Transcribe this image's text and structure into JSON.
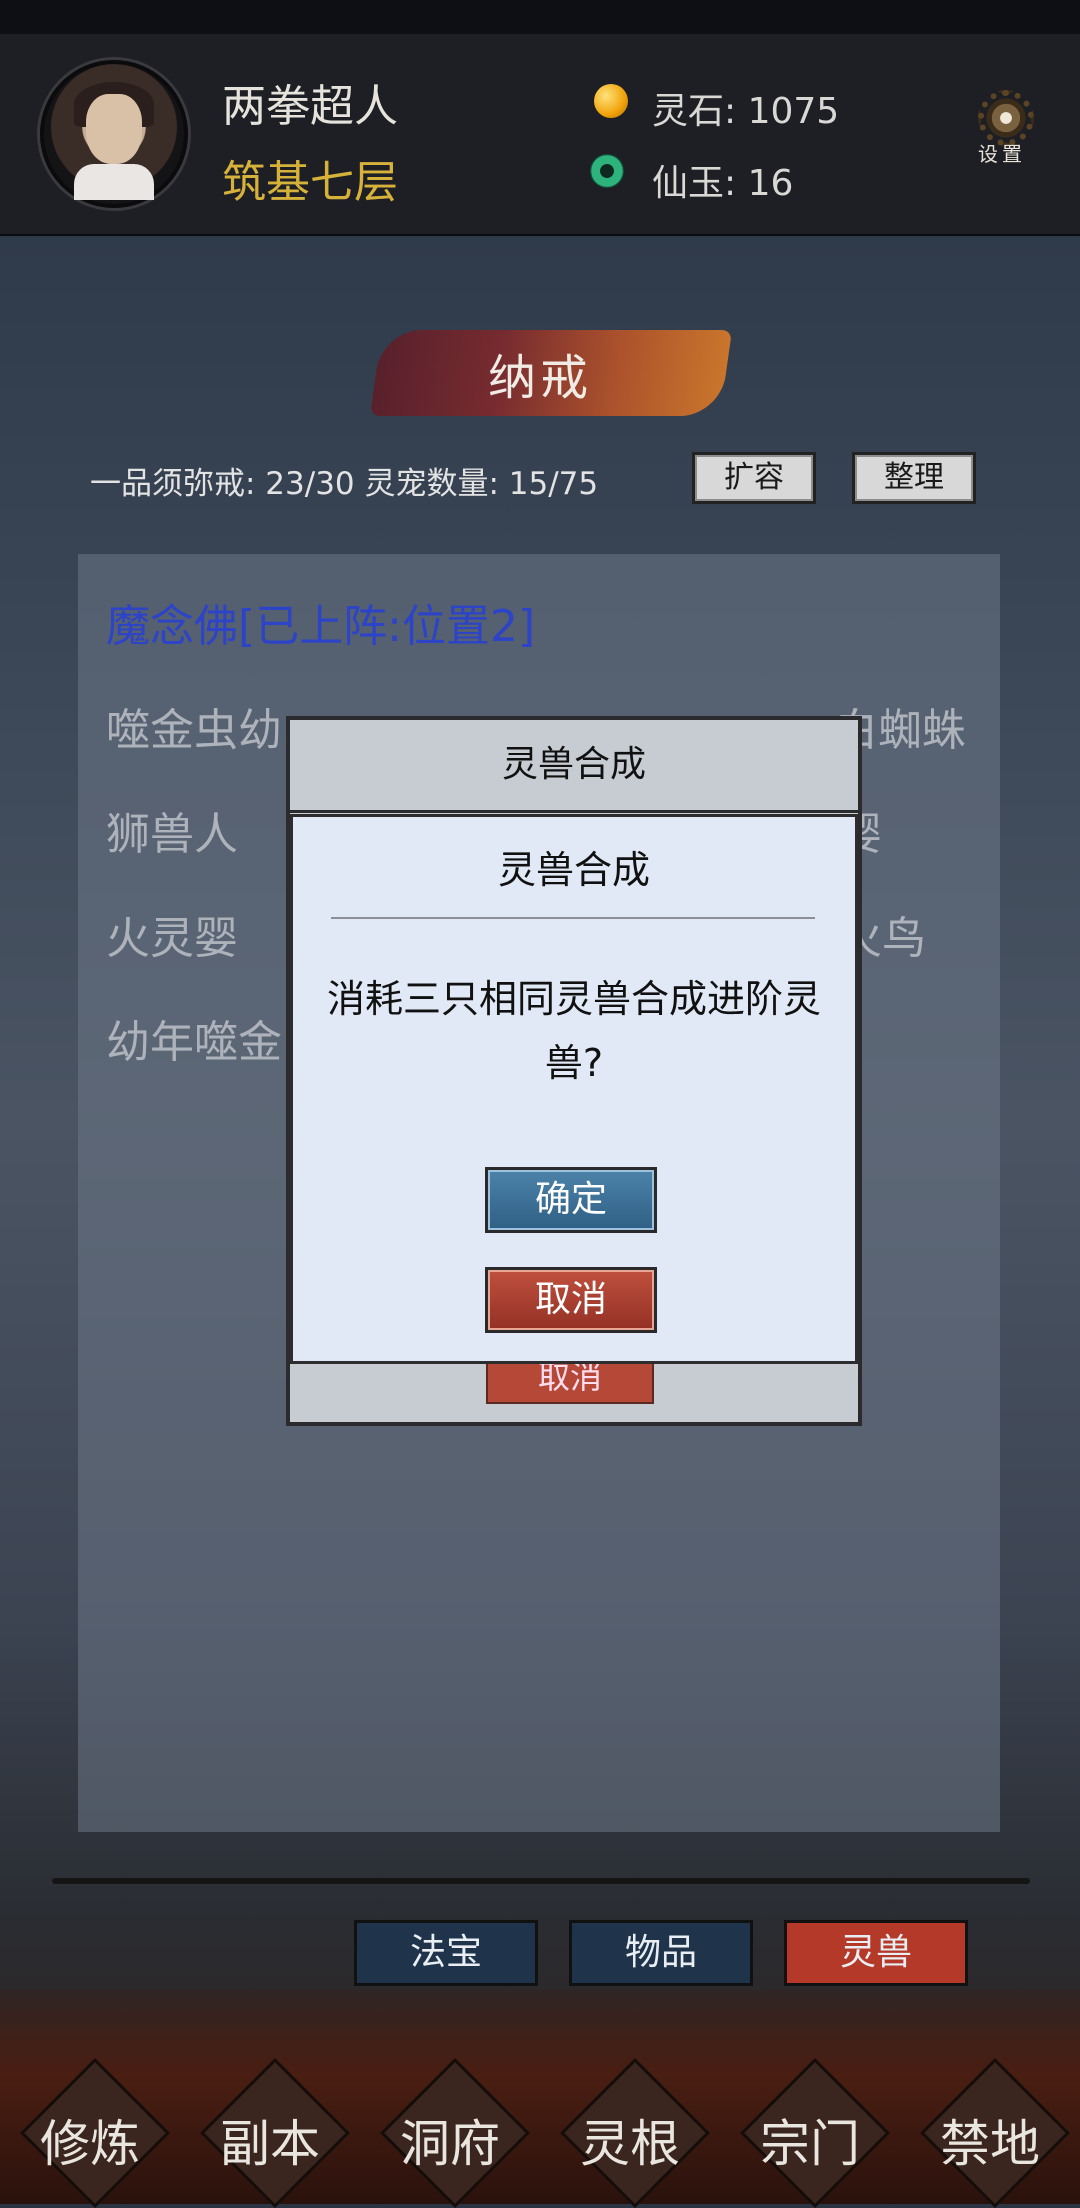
{
  "header": {
    "player_name": "两拳超人",
    "rank": "筑基七层",
    "resources": [
      {
        "icon": "spirit-stone-icon",
        "label": "灵石: 1075"
      },
      {
        "icon": "immortal-jade-icon",
        "label": "仙玉: 16"
      }
    ],
    "settings_label": "设置"
  },
  "page": {
    "title": "纳戒",
    "capacity": "一品须弥戒: 23/30  灵宠数量: 15/75",
    "expand_label": "扩容",
    "sort_label": "整理"
  },
  "beasts": {
    "left": [
      "魔念佛[已上阵:位置2]",
      "噬金虫幼",
      "狮兽人",
      "火灵婴",
      "幼年噬金"
    ],
    "right_visible": [
      "一白蜘蛛",
      "婴",
      "火鸟"
    ]
  },
  "dialog_back": {
    "title": "灵兽合成",
    "cancel_label": "取消"
  },
  "dialog": {
    "title": "灵兽合成",
    "message": "消耗三只相同灵兽合成进阶灵兽?",
    "confirm_label": "确定",
    "cancel_label": "取消"
  },
  "tabs": [
    {
      "label": "法宝",
      "color": "#1f344a"
    },
    {
      "label": "物品",
      "color": "#1f344a"
    },
    {
      "label": "灵兽",
      "color": "#b53928",
      "active": true
    }
  ],
  "bottom_nav": [
    "修炼",
    "副本",
    "洞府",
    "灵根",
    "宗门",
    "禁地"
  ]
}
